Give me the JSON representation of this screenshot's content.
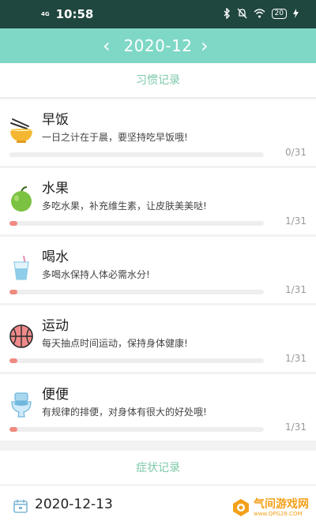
{
  "status_bar": {
    "time": "10:58",
    "network": "4G",
    "battery": "20"
  },
  "header": {
    "title": "2020-12",
    "prev": "‹",
    "next": "›"
  },
  "habit_section": {
    "title": "习惯记录"
  },
  "habits": [
    {
      "title": "早饭",
      "desc": "一日之计在于晨，要坚持吃早饭哦!",
      "count": "0/31",
      "progress": 0,
      "icon": "noodle-bowl-icon"
    },
    {
      "title": "水果",
      "desc": "多吃水果，补充维生素，让皮肤美美哒!",
      "count": "1/31",
      "progress": 0.032,
      "icon": "apple-icon"
    },
    {
      "title": "喝水",
      "desc": "多喝水保持人体必需水分!",
      "count": "1/31",
      "progress": 0.032,
      "icon": "water-cup-icon"
    },
    {
      "title": "运动",
      "desc": "每天抽点时间运动，保持身体健康!",
      "count": "1/31",
      "progress": 0.032,
      "icon": "basketball-icon"
    },
    {
      "title": "便便",
      "desc": "有规律的排便，对身体有很大的好处哦!",
      "count": "1/31",
      "progress": 0.032,
      "icon": "toilet-icon"
    }
  ],
  "symptom_section": {
    "title": "症状记录"
  },
  "diary": {
    "date": "2020-12-13"
  },
  "watermark": {
    "text": "气间游戏网",
    "url": "www.QPG28.COM"
  },
  "colors": {
    "header_bg": "#7fd8c6",
    "status_bg": "#1f463f",
    "progress_fill": "#ef8a80",
    "section_title": "#7cc9a8"
  }
}
